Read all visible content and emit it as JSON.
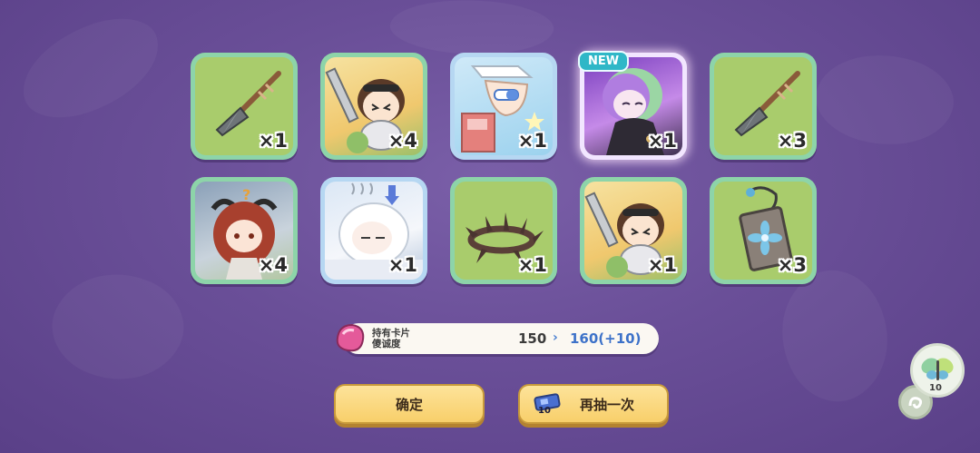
{
  "cards": [
    {
      "item": "spear-tip",
      "quantity": "×1",
      "new": false
    },
    {
      "item": "knight-girl-portrait",
      "quantity": "×4",
      "new": false
    },
    {
      "item": "pill-hand",
      "quantity": "×1",
      "new": false
    },
    {
      "item": "dark-girl-portrait",
      "quantity": "×1",
      "new": true,
      "badge": "NEW"
    },
    {
      "item": "spear-tip",
      "quantity": "×3",
      "new": false
    },
    {
      "item": "red-hair-demon-girl-portrait",
      "quantity": "×4",
      "new": false
    },
    {
      "item": "white-hair-sleeping-girl-portrait",
      "quantity": "×1",
      "new": false
    },
    {
      "item": "thorn-crown",
      "quantity": "×1",
      "new": false
    },
    {
      "item": "knight-girl-portrait",
      "quantity": "×1",
      "new": false
    },
    {
      "item": "flower-pendant",
      "quantity": "×3",
      "new": false
    }
  ],
  "info": {
    "label_line1": "持有卡片",
    "label_line2": "傻诚度",
    "old_value": "150",
    "arrow": "›",
    "new_value": "160(+10)"
  },
  "buttons": {
    "confirm": "确定",
    "draw_again": "再抽一次",
    "ticket_count": "10"
  },
  "side": {
    "count": "10"
  },
  "colors": {
    "background": "#6a4f98",
    "card_border": "#8dd4a9",
    "button": "#f8cf6a",
    "new_badge": "#2fb7c7",
    "accent_value": "#3d72c9"
  }
}
